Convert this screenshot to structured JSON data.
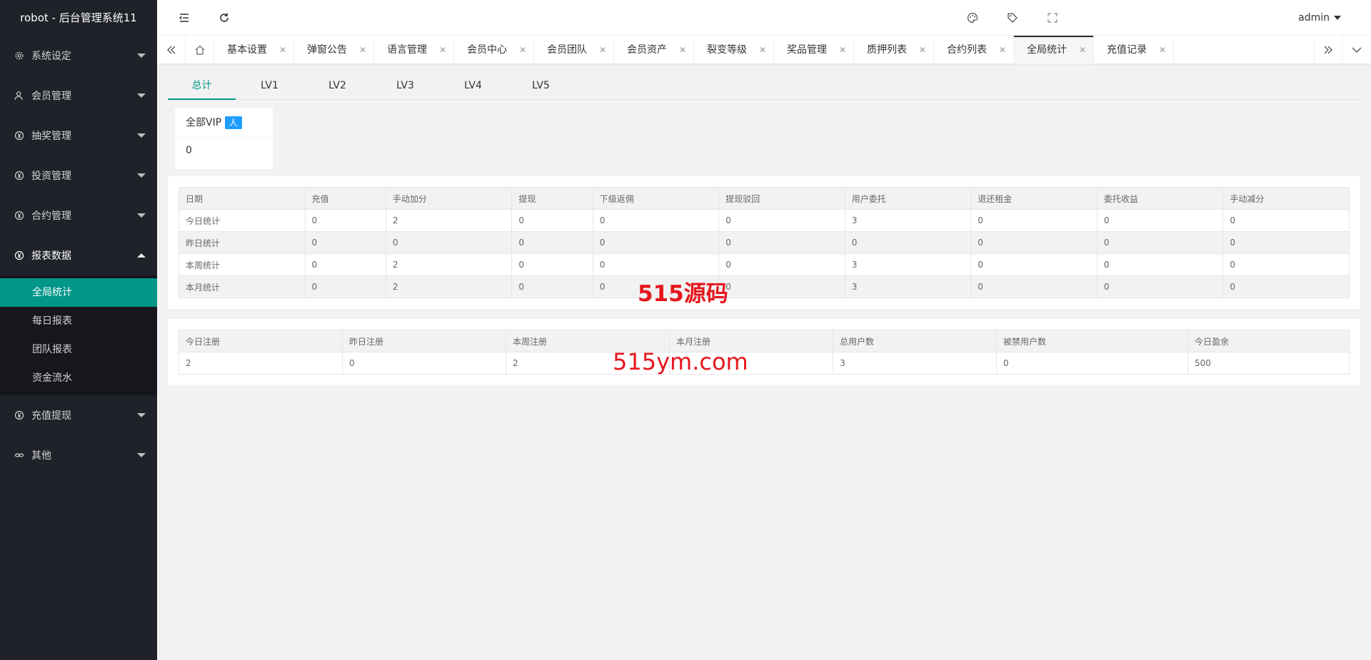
{
  "app": {
    "title": "robot - 后台管理系统11"
  },
  "sidebar": {
    "items": [
      {
        "label": "系统设定",
        "icon": "gear-icon"
      },
      {
        "label": "会员管理",
        "icon": "user-icon"
      },
      {
        "label": "抽奖管理",
        "icon": "yen-circle-icon"
      },
      {
        "label": "投资管理",
        "icon": "yen-circle-icon"
      },
      {
        "label": "合约管理",
        "icon": "yen-circle-icon"
      },
      {
        "label": "报表数据",
        "icon": "yen-circle-icon"
      },
      {
        "label": "充值提现",
        "icon": "yen-circle-icon"
      },
      {
        "label": "其他",
        "icon": "link-icon"
      }
    ],
    "report_sub": [
      "全局统计",
      "每日报表",
      "团队报表",
      "资金流水"
    ]
  },
  "header": {
    "user": "admin"
  },
  "tabs": [
    "基本设置",
    "弹窗公告",
    "语言管理",
    "会员中心",
    "会员团队",
    "会员资产",
    "裂变等级",
    "奖品管理",
    "质押列表",
    "合约列表",
    "全局统计",
    "充值记录"
  ],
  "active_tab": "全局统计",
  "level_tabs": [
    "总计",
    "LV1",
    "LV2",
    "LV3",
    "LV4",
    "LV5"
  ],
  "vip_card": {
    "title": "全部VIP",
    "badge": "人",
    "value": "0"
  },
  "stats_table": {
    "headers": [
      "日期",
      "充值",
      "手动加分",
      "提现",
      "下级返佣",
      "提现驳回",
      "用户委托",
      "退还租金",
      "委托收益",
      "手动减分"
    ],
    "rows": [
      [
        "今日统计",
        "0",
        "2",
        "0",
        "0",
        "0",
        "3",
        "0",
        "0",
        "0"
      ],
      [
        "昨日统计",
        "0",
        "0",
        "0",
        "0",
        "0",
        "0",
        "0",
        "0",
        "0"
      ],
      [
        "本周统计",
        "0",
        "2",
        "0",
        "0",
        "0",
        "3",
        "0",
        "0",
        "0"
      ],
      [
        "本月统计",
        "0",
        "2",
        "0",
        "0",
        "0",
        "3",
        "0",
        "0",
        "0"
      ]
    ]
  },
  "reg_table": {
    "headers": [
      "今日注册",
      "昨日注册",
      "本周注册",
      "本月注册",
      "总用户数",
      "被禁用户数",
      "今日盈余"
    ],
    "row": [
      "2",
      "0",
      "2",
      "",
      "3",
      "0",
      "500"
    ]
  },
  "watermarks": [
    "515源码",
    "515ym.com"
  ],
  "colors": {
    "accent": "#009688",
    "sidebar_bg": "#20222a",
    "badge": "#1e9fff",
    "watermark": "#e5161d"
  }
}
